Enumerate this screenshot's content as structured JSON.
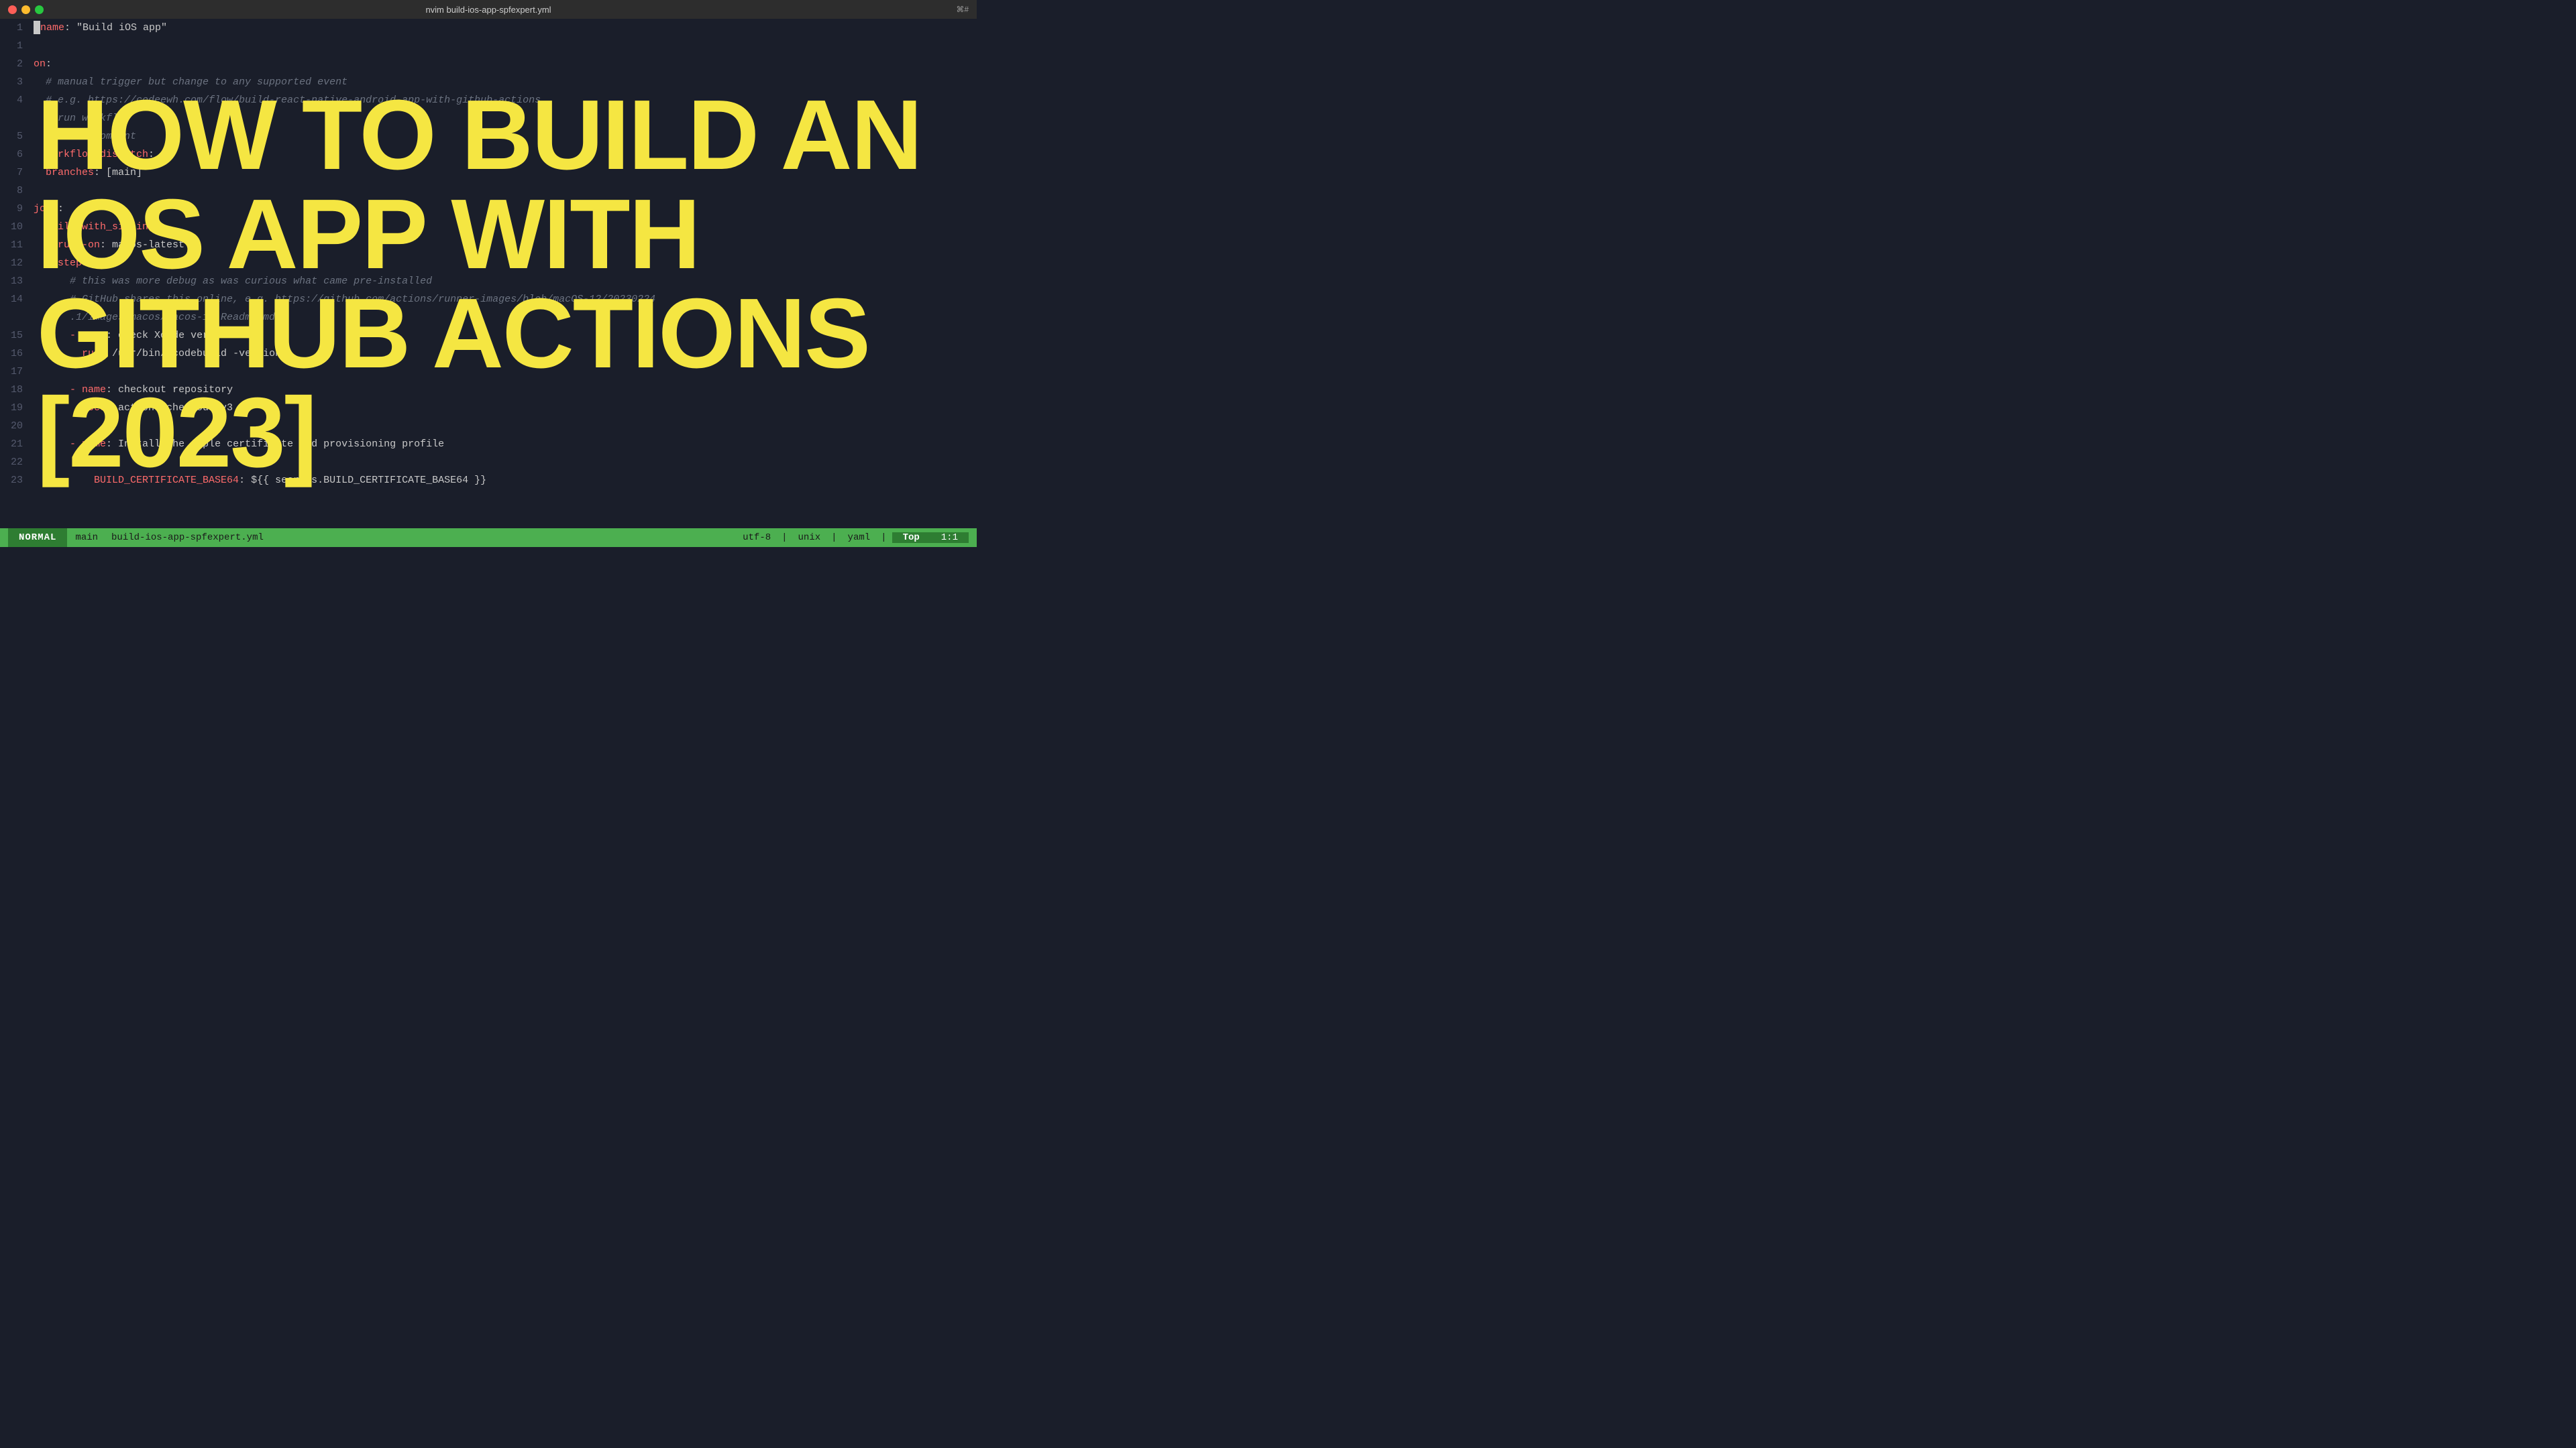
{
  "titleBar": {
    "title": "nvim build-ios-app-spfexpert.yml",
    "shortcut": "⌘#",
    "trafficLights": [
      "close",
      "minimize",
      "maximize"
    ]
  },
  "overlay": {
    "line1": "HOW TO BUILD AN",
    "line2": "IOS APP WITH",
    "line3": "GITHUB ACTIONS [2023]"
  },
  "lines": [
    {
      "num": "1",
      "content": "name: \"Build iOS app\"",
      "type": "key-string"
    },
    {
      "num": "1",
      "content": "",
      "type": "empty"
    },
    {
      "num": "2",
      "content": "on:",
      "type": "key"
    },
    {
      "num": "3",
      "content": "  # manual trigger but change to any supported event",
      "type": "comment"
    },
    {
      "num": "4",
      "content": "  # e.g. https://codeewh.com/flow/build-react-native-android-app-with-github-actions",
      "type": "comment"
    },
    {
      "num": "",
      "content": "  # run workflow",
      "type": "comment"
    },
    {
      "num": "5",
      "content": "  # addat comment",
      "type": "comment"
    },
    {
      "num": "6",
      "content": "  workflow_dispatch:",
      "type": "key"
    },
    {
      "num": "7",
      "content": "  branches: [main]",
      "type": "key-value"
    },
    {
      "num": "8",
      "content": "",
      "type": "empty"
    },
    {
      "num": "9",
      "content": "jobs:",
      "type": "key"
    },
    {
      "num": "10",
      "content": "  build_with_signing:",
      "type": "key"
    },
    {
      "num": "11",
      "content": "    runs-on: macos-latest",
      "type": "key-value"
    },
    {
      "num": "12",
      "content": "    steps:",
      "type": "key"
    },
    {
      "num": "13",
      "content": "      # this was more debug as was curious what came pre-installed",
      "type": "comment"
    },
    {
      "num": "14",
      "content": "      # GitHub shares this online, e.g. https://github.com/actions/runner-images/blob/macOS-12/20230224",
      "type": "comment"
    },
    {
      "num": "",
      "content": "      .1/images/macos/macos-12-Readme.md",
      "type": "comment"
    },
    {
      "num": "15",
      "content": "      - name: check Xcode version",
      "type": "key-value"
    },
    {
      "num": "16",
      "content": "        run: /usr/bin/xcodebuild -version",
      "type": "key-value"
    },
    {
      "num": "17",
      "content": "",
      "type": "empty"
    },
    {
      "num": "18",
      "content": "      - name: checkout repository",
      "type": "key-value"
    },
    {
      "num": "19",
      "content": "        uses: actions/checkout@v3",
      "type": "key-value"
    },
    {
      "num": "20",
      "content": "",
      "type": "empty"
    },
    {
      "num": "21",
      "content": "      - name: Install the Apple certificate and provisioning profile",
      "type": "key-value"
    },
    {
      "num": "22",
      "content": "        env:",
      "type": "key"
    },
    {
      "num": "23",
      "content": "          BUILD_CERTIFICATE_BASE64: ${{ secrets.BUILD_CERTIFICATE_BASE64 }}",
      "type": "env-line"
    }
  ],
  "statusBar": {
    "mode": "NORMAL",
    "branch": "main",
    "filename": "build-ios-app-spfexpert.yml",
    "encoding": "utf-8",
    "lineending": "unix",
    "filetype": "yaml",
    "position": "Top",
    "cursor": "1:1"
  }
}
